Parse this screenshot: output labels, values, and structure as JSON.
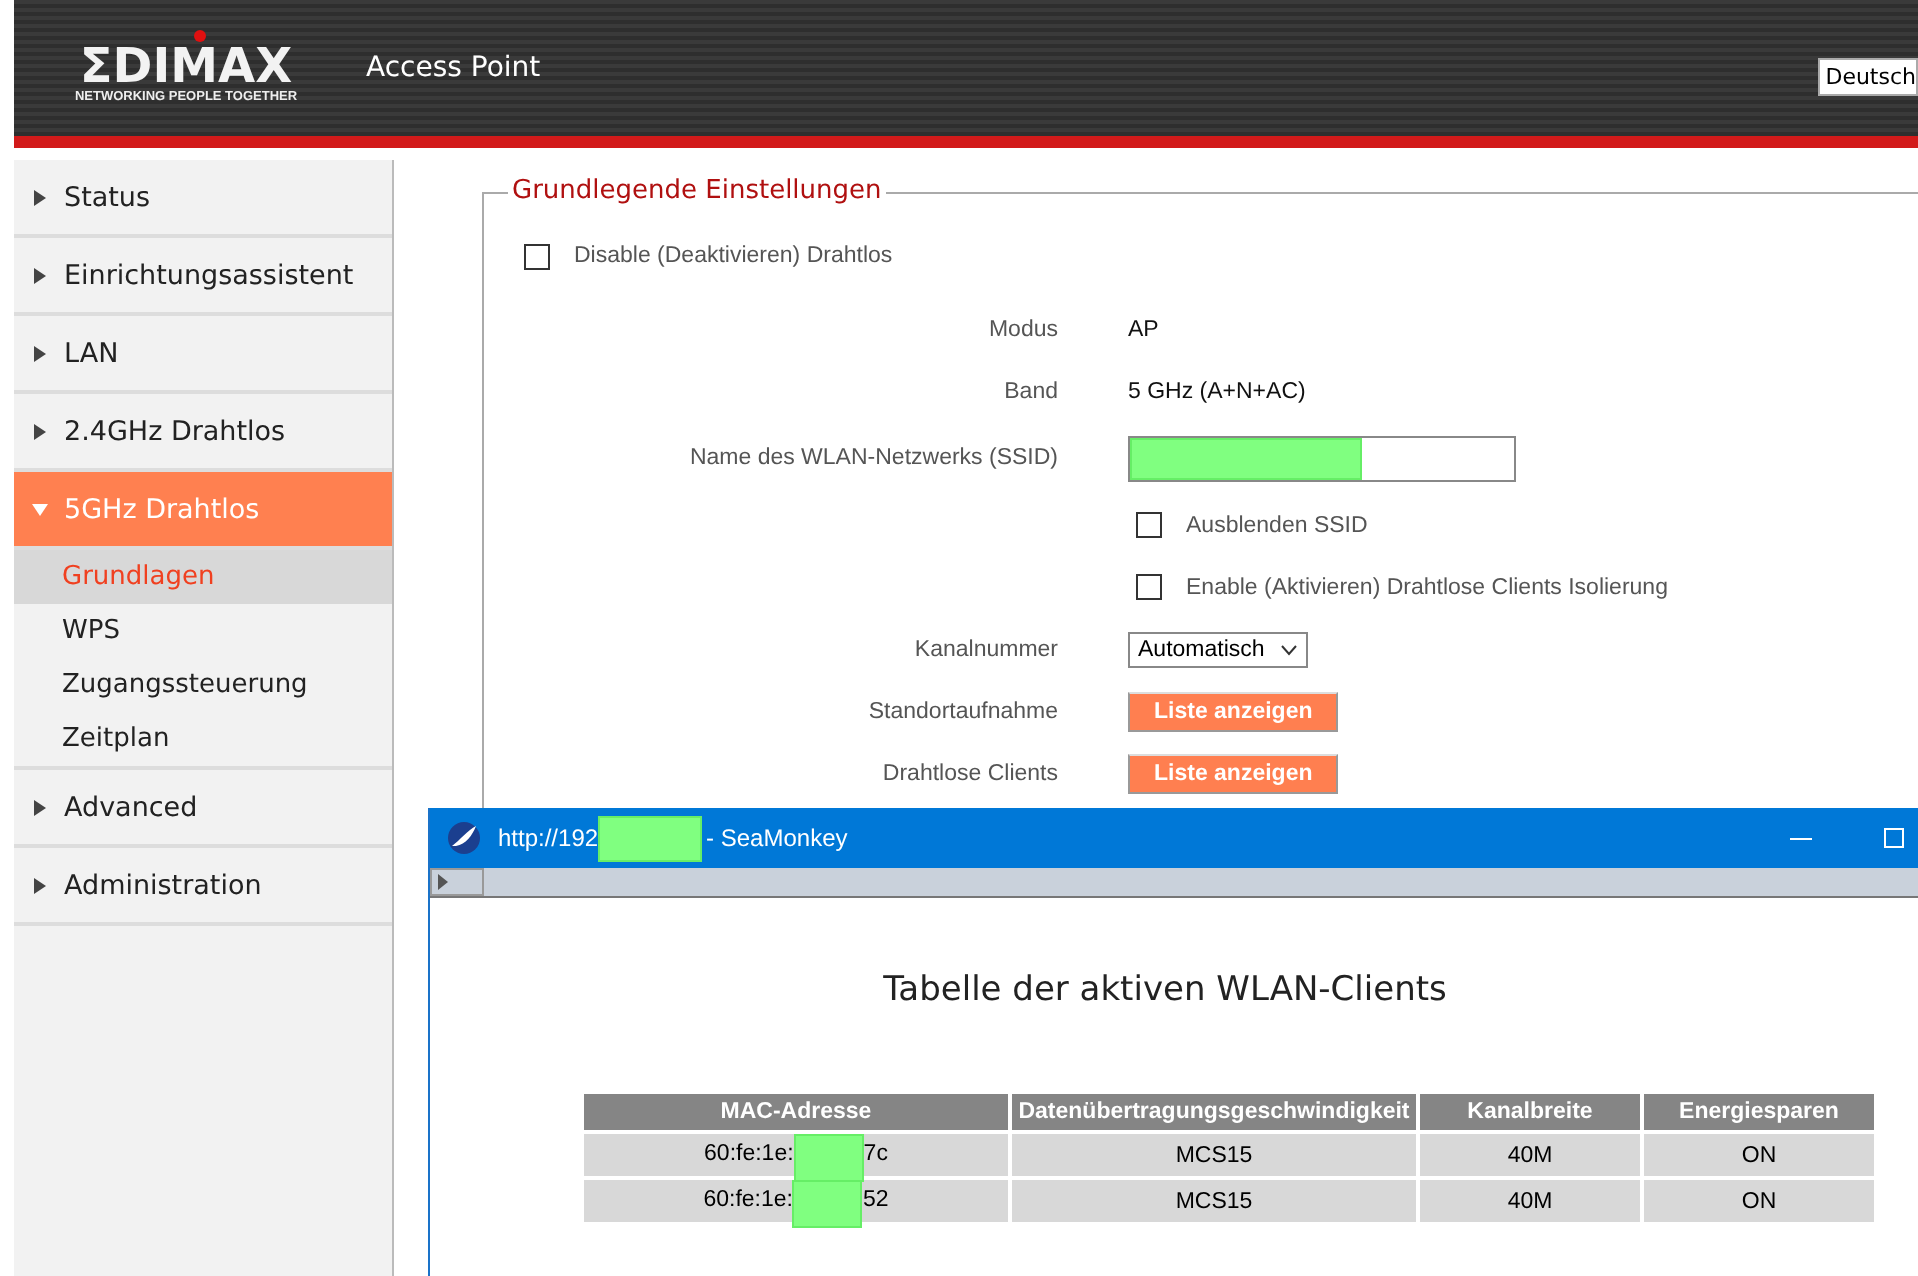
{
  "header": {
    "logo": "ΣDIMAX",
    "tagline": "NETWORKING PEOPLE TOGETHER",
    "title": "Access Point",
    "language": "Deutsch"
  },
  "sidebar": {
    "items": [
      {
        "label": "Status",
        "expanded": false,
        "selected": false
      },
      {
        "label": "Einrichtungsassistent",
        "expanded": false,
        "selected": false
      },
      {
        "label": "LAN",
        "expanded": false,
        "selected": false
      },
      {
        "label": "2.4GHz Drahtlos",
        "expanded": false,
        "selected": false
      },
      {
        "label": "5GHz Drahtlos",
        "expanded": true,
        "selected": true,
        "children": [
          {
            "label": "Grundlagen",
            "selected": true
          },
          {
            "label": "WPS",
            "selected": false
          },
          {
            "label": "Zugangssteuerung",
            "selected": false
          },
          {
            "label": "Zeitplan",
            "selected": false
          }
        ]
      },
      {
        "label": "Advanced",
        "expanded": false,
        "selected": false
      },
      {
        "label": "Administration",
        "expanded": false,
        "selected": false
      }
    ]
  },
  "settings": {
    "legend": "Grundlegende Einstellungen",
    "disable_wireless": {
      "label": "Disable (Deaktivieren)  Drahtlos",
      "checked": false
    },
    "rows": [
      {
        "kind": "text",
        "label": "Modus",
        "value": "AP"
      },
      {
        "kind": "text",
        "label": "Band",
        "value": "5 GHz (A+N+AC)"
      },
      {
        "kind": "field",
        "label": "Name des WLAN-Netzwerks  (SSID)",
        "redacted": true
      },
      {
        "kind": "checkbox",
        "label": "Ausblenden SSID",
        "checked": false
      },
      {
        "kind": "checkbox",
        "label": "Enable (Aktivieren) Drahtlose Clients Isolierung",
        "checked": false
      },
      {
        "kind": "select",
        "label": "Kanalnummer",
        "value": "Automatisch"
      },
      {
        "kind": "button",
        "label": "Standortaufnahme",
        "value": "Liste anzeigen"
      },
      {
        "kind": "button",
        "label": "Drahtlose Clients",
        "value": "Liste anzeigen"
      }
    ]
  },
  "popup": {
    "url_prefix": "http://192",
    "url_redacted": true,
    "app_title": "- SeaMonkey",
    "heading": "Tabelle der aktiven WLAN-Clients",
    "columns": [
      "MAC-Adresse",
      "Datenübertragungsgeschwindigkeit",
      "Kanalbreite",
      "Energiesparen"
    ],
    "rows": [
      {
        "cells": [
          {
            "text": "60:fe:1e:",
            "text_after": "7c",
            "redacted": true
          },
          {
            "text": "MCS15"
          },
          {
            "text": "40M"
          },
          {
            "text": "ON"
          }
        ]
      },
      {
        "cells": [
          {
            "text": "60:fe:1e:",
            "text_after": "52",
            "redacted": true
          },
          {
            "text": "MCS15"
          },
          {
            "text": "40M"
          },
          {
            "text": "ON"
          }
        ]
      }
    ]
  }
}
